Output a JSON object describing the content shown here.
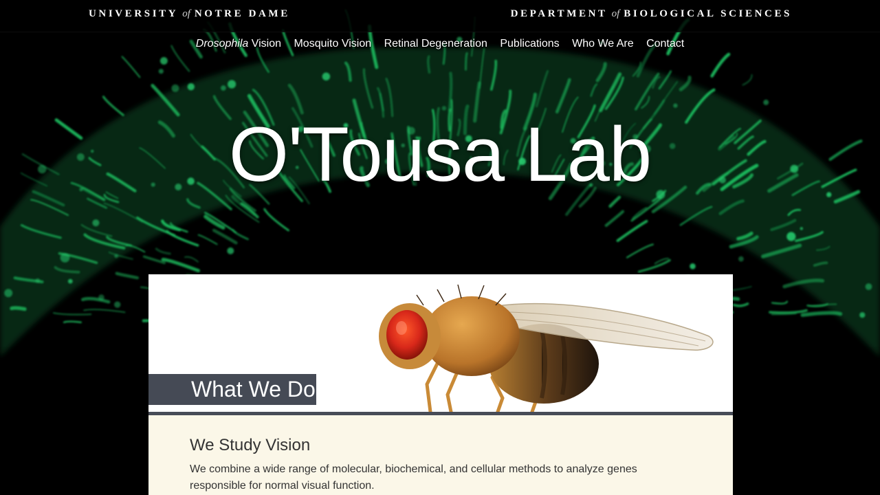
{
  "header": {
    "left_wordmark": {
      "pre": "UNIVERSITY",
      "of": "of",
      "post": "NOTRE DAME"
    },
    "right_wordmark": {
      "pre": "DEPARTMENT",
      "of": "of",
      "post": "BIOLOGICAL SCIENCES"
    }
  },
  "nav": {
    "items": [
      {
        "label_italic": "Drosophila",
        "label": "Vision"
      },
      {
        "label": "Mosquito Vision"
      },
      {
        "label": "Retinal Degeneration"
      },
      {
        "label": "Publications"
      },
      {
        "label": "Who We Are"
      },
      {
        "label": "Contact"
      }
    ]
  },
  "hero": {
    "title": "O'Tousa Lab",
    "background": "green-fluorescent-retina-image"
  },
  "feature": {
    "section_tab": "What We Do",
    "image": "fruit-fly-photo",
    "heading": "We Study Vision",
    "body": "We combine a wide range of molecular, biochemical, and cellular methods to analyze genes responsible for normal visual function."
  },
  "colors": {
    "background": "#000000",
    "accent_green": "#1fcf68",
    "tab_slate": "#454a55",
    "panel_cream": "#fbf7e8"
  }
}
